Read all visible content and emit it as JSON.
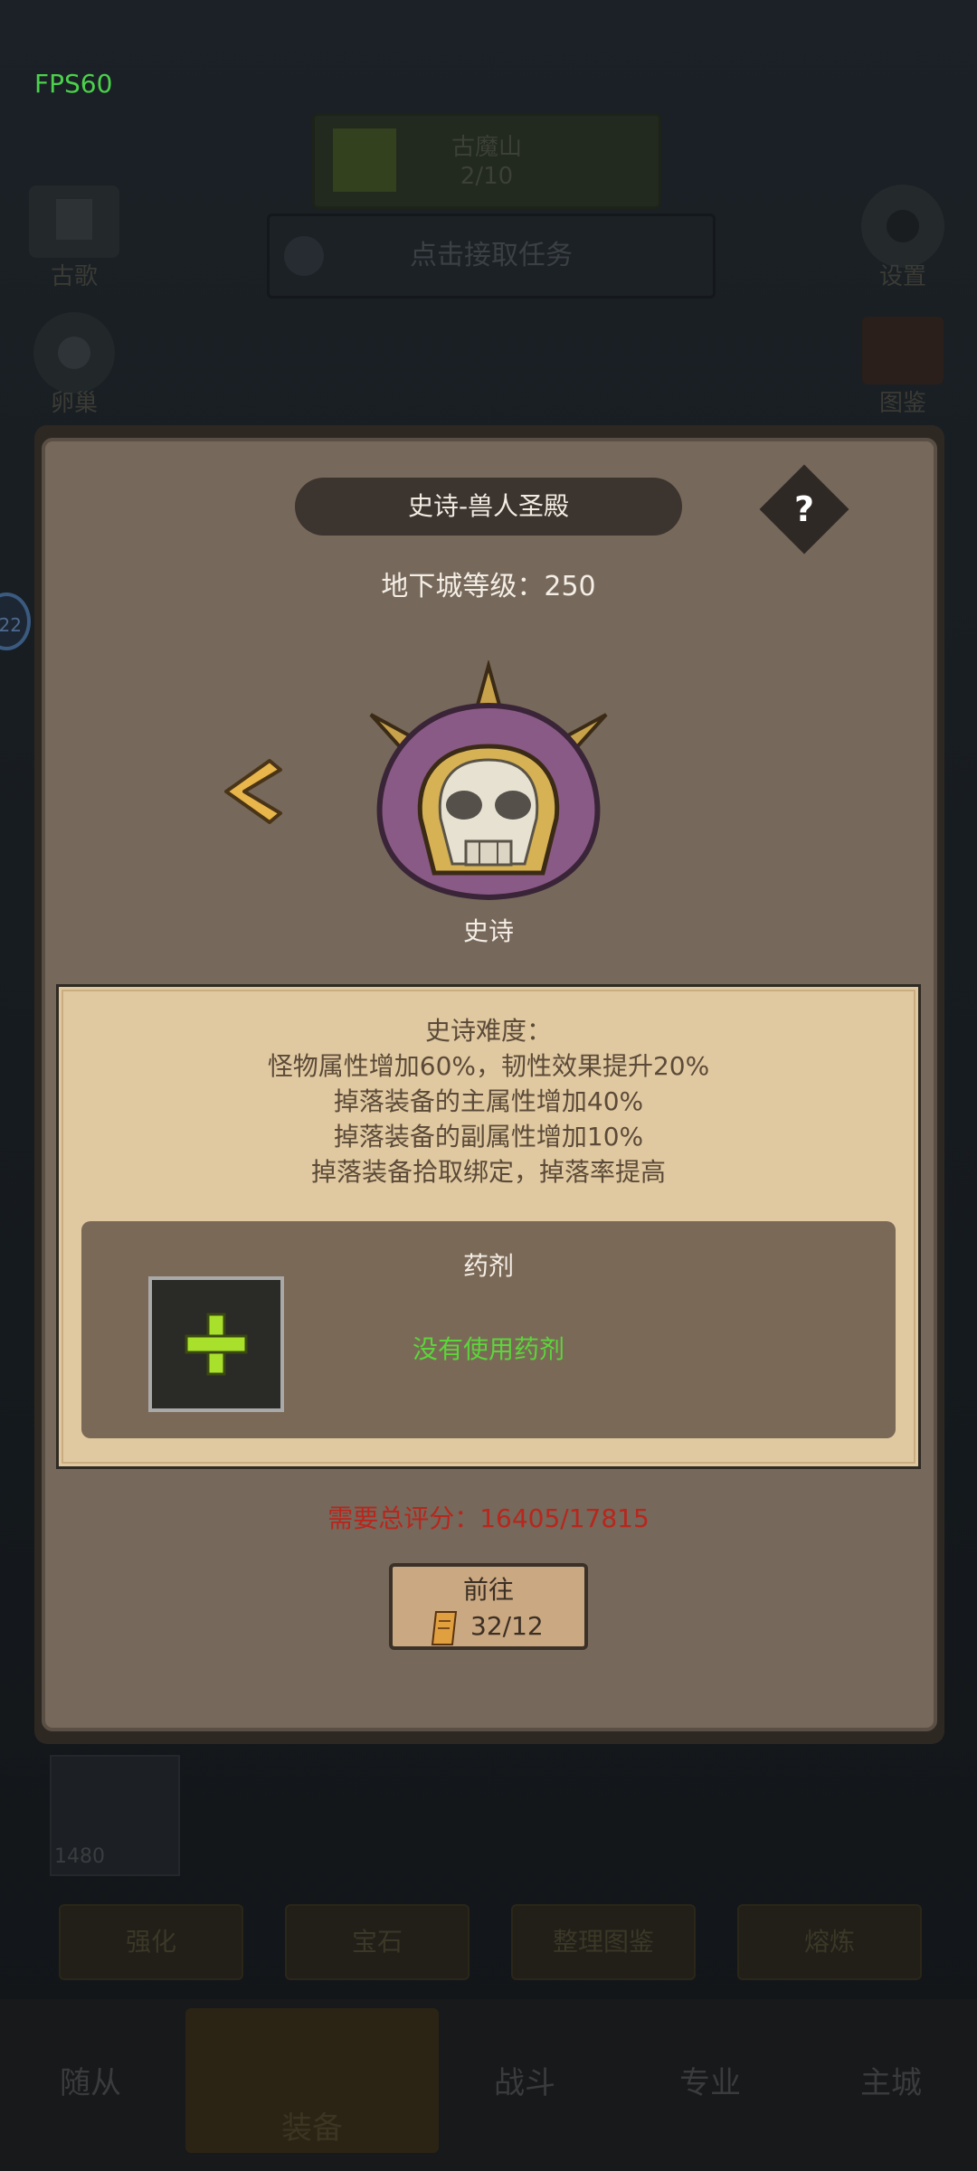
{
  "hud": {
    "fps": "FPS60",
    "quest_name": "古魔山",
    "quest_progress": "2/10",
    "accept_task": "点击接取任务",
    "left_top_label": "古歌",
    "left_mid_label": "卵巢",
    "right_top_label": "设置",
    "right_mid_label": "图鉴",
    "bubble_count": "22",
    "item_count": "1480"
  },
  "subtabs": [
    "强化",
    "宝石",
    "整理图鉴",
    "熔炼"
  ],
  "nav": {
    "left": "随从",
    "equip": "装备",
    "battle": "战斗",
    "profession": "专业",
    "city": "主城"
  },
  "dialog": {
    "title": "史诗-兽人圣殿",
    "help": "?",
    "level_line": "地下城等级：250",
    "tier_label": "史诗",
    "desc_title": "史诗难度：",
    "desc_lines": [
      "怪物属性增加60%，韧性效果提升20%",
      "掉落装备的主属性增加40%",
      "掉落装备的副属性增加10%",
      "掉落装备拾取绑定，掉落率提高"
    ],
    "potion_title": "药剂",
    "no_potion": "没有使用药剂",
    "required_score": "需要总评分：16405/17815",
    "go_label": "前往",
    "go_cost": "32/12"
  },
  "colors": {
    "accent_green": "#5bd63a",
    "warning_red": "#b8261d",
    "panel_brown": "#76685a",
    "parchment": "#e0c9a1"
  }
}
